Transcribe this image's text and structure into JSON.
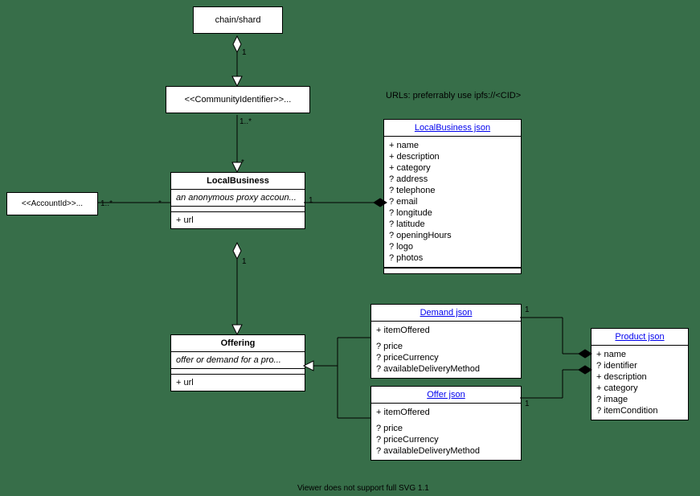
{
  "note_urls": "URLs: preferrably use ipfs://<CID>",
  "footer": "Viewer does not support full SVG 1.1",
  "boxes": {
    "chain": {
      "title": "chain/shard"
    },
    "community": {
      "title": "<<CommunityIdentifier>>..."
    },
    "account": {
      "title": "<<AccountId>>..."
    },
    "localbiz": {
      "title": "LocalBusiness",
      "sub": "an anonymous proxy accoun...",
      "url": "+ url"
    },
    "offering": {
      "title": "Offering",
      "sub": "offer or demand for a pro...",
      "url": "+ url"
    },
    "localbiz_json": {
      "title": "LocalBusiness json",
      "attrs": [
        "+ name",
        "+ description",
        "+ category",
        "? address",
        "? telephone",
        "? email",
        "? longitude",
        "? latitude",
        "? openingHours",
        "? logo",
        "? photos"
      ]
    },
    "demand_json": {
      "title": "Demand json",
      "attrs": [
        "+ itemOffered",
        "? price",
        "? priceCurrency",
        "? availableDeliveryMethod"
      ]
    },
    "offer_json": {
      "title": "Offer json",
      "attrs": [
        "+ itemOffered",
        "? price",
        "? priceCurrency",
        "? availableDeliveryMethod"
      ]
    },
    "product_json": {
      "title": "Product json",
      "attrs": [
        "+ name",
        "? identifier",
        "+ description",
        "+ category",
        "? image",
        "? itemCondition"
      ]
    }
  },
  "mult": {
    "chain_1": "1",
    "community_1star": "1..*",
    "community_star": "*",
    "account_1star": "1..*",
    "localbiz_left_star": "*",
    "localbiz_right_1": "1",
    "offering_diamond_1": "1",
    "demand_1": "1",
    "offer_1": "1"
  }
}
